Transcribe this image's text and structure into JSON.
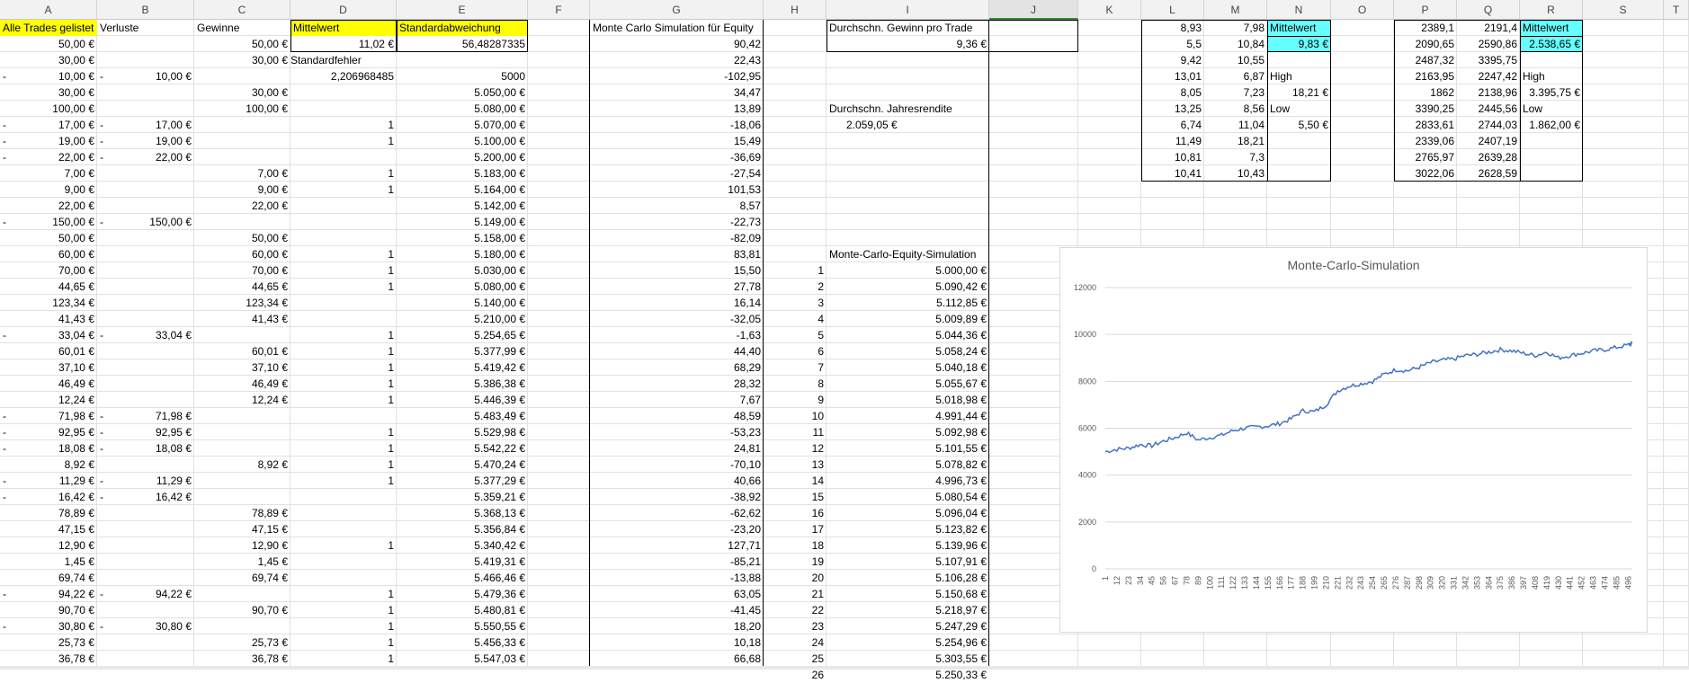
{
  "columns": [
    "A",
    "B",
    "C",
    "D",
    "E",
    "F",
    "G",
    "H",
    "I",
    "J",
    "K",
    "L",
    "M",
    "N",
    "O",
    "P",
    "Q",
    "R",
    "S",
    "T"
  ],
  "selected_column": "J",
  "header_row": {
    "A": "Alle Trades gelistet",
    "B": "Verluste",
    "C": "Gewinne",
    "D": "Mittelwert",
    "E": "Standardabweichung",
    "G": "Monte Carlo Simulation für Equity",
    "I": "Durchschn. Gewinn pro Trade",
    "L": "8,93",
    "M": "7,98",
    "N": "Mittelwert",
    "P": "2389,1",
    "Q": "2191,4",
    "R": "Mittelwert"
  },
  "stats": {
    "mean": "11,02 €",
    "stddev": "56,48287335",
    "std_error_label": "Standardfehler",
    "std_error": "2,206968485",
    "start_capital": "5000",
    "avg_gain_value": "9,36 €",
    "avg_yearly_label": "Durchschn. Jahresrendite",
    "avg_yearly_value": "2.059,05 €",
    "equity_sim_label": "Monte-Carlo-Equity-Simulation"
  },
  "small_table1": {
    "L": [
      "5,5",
      "9,42",
      "13,01",
      "8,05",
      "13,25",
      "6,74",
      "11,49",
      "10,81",
      "10,41"
    ],
    "M": [
      "10,84",
      "10,55",
      "6,87",
      "7,23",
      "8,56",
      "11,04",
      "18,21",
      "7,3",
      "10,43"
    ],
    "N": [
      "9,83 €",
      "",
      "High",
      "18,21 €",
      "Low",
      "5,50 €",
      "",
      "",
      ""
    ]
  },
  "small_table2": {
    "P": [
      "2090,65",
      "2487,32",
      "2163,95",
      "1862",
      "3390,25",
      "2833,61",
      "2339,06",
      "2765,97",
      "3022,06"
    ],
    "Q": [
      "2590,86",
      "3395,75",
      "2247,42",
      "2138,96",
      "2445,56",
      "2744,03",
      "2407,19",
      "2639,28",
      "2628,59"
    ],
    "R": [
      "2.538,65 €",
      "",
      "High",
      "3.395,75 €",
      "Low",
      "1.862,00 €",
      "",
      "",
      ""
    ]
  },
  "colA": [
    "50,00 €",
    "30,00 €",
    "-  10,00 €",
    "30,00 €",
    "100,00 €",
    "-  17,00 €",
    "-  19,00 €",
    "-  22,00 €",
    "7,00 €",
    "9,00 €",
    "22,00 €",
    "-  150,00 €",
    "50,00 €",
    "60,00 €",
    "70,00 €",
    "44,65 €",
    "123,34 €",
    "41,43 €",
    "-  33,04 €",
    "60,01 €",
    "37,10 €",
    "46,49 €",
    "12,24 €",
    "-  71,98 €",
    "-  92,95 €",
    "-  18,08 €",
    "8,92 €",
    "-  11,29 €",
    "-  16,42 €",
    "78,89 €",
    "47,15 €",
    "12,90 €",
    "1,45 €",
    "69,74 €",
    "-  94,22 €",
    "90,70 €",
    "-  30,80 €",
    "25,73 €",
    "36,78 €"
  ],
  "colB": [
    "",
    "",
    "10,00 €",
    "",
    "",
    "17,00 €",
    "19,00 €",
    "22,00 €",
    "",
    "",
    "",
    "150,00 €",
    "",
    "",
    "",
    "",
    "",
    "",
    "33,04 €",
    "",
    "",
    "",
    "",
    "71,98 €",
    "92,95 €",
    "18,08 €",
    "",
    "11,29 €",
    "16,42 €",
    "",
    "",
    "",
    "",
    "",
    "94,22 €",
    "",
    "30,80 €",
    "",
    ""
  ],
  "colC": [
    "50,00 €",
    "30,00 €",
    "",
    "30,00 €",
    "100,00 €",
    "",
    "",
    "",
    "7,00 €",
    "9,00 €",
    "22,00 €",
    "",
    "50,00 €",
    "60,00 €",
    "70,00 €",
    "44,65 €",
    "123,34 €",
    "41,43 €",
    "",
    "60,01 €",
    "37,10 €",
    "46,49 €",
    "12,24 €",
    "",
    "",
    "",
    "8,92 €",
    "",
    "",
    "78,89 €",
    "47,15 €",
    "12,90 €",
    "1,45 €",
    "69,74 €",
    "",
    "90,70 €",
    "",
    "25,73 €",
    "36,78 €"
  ],
  "colD": [
    "",
    "",
    "",
    "",
    "",
    "1",
    "1",
    "",
    "1",
    "1",
    "",
    "",
    "",
    "1",
    "1",
    "1",
    "",
    "",
    "1",
    "1",
    "1",
    "1",
    "1",
    "",
    "1",
    "1",
    "1",
    "1",
    "",
    "",
    "",
    "1",
    "",
    "",
    "1",
    "1",
    "1",
    "1",
    "1"
  ],
  "colE": [
    "",
    "",
    "",
    "5.050,00 €",
    "5.080,00 €",
    "5.070,00 €",
    "5.100,00 €",
    "5.200,00 €",
    "5.183,00 €",
    "5.164,00 €",
    "5.142,00 €",
    "5.149,00 €",
    "5.158,00 €",
    "5.180,00 €",
    "5.030,00 €",
    "5.080,00 €",
    "5.140,00 €",
    "5.210,00 €",
    "5.254,65 €",
    "5.377,99 €",
    "5.419,42 €",
    "5.386,38 €",
    "5.446,39 €",
    "5.483,49 €",
    "5.529,98 €",
    "5.542,22 €",
    "5.470,24 €",
    "5.377,29 €",
    "5.359,21 €",
    "5.368,13 €",
    "5.356,84 €",
    "5.340,42 €",
    "5.419,31 €",
    "5.466,46 €",
    "5.479,36 €",
    "5.480,81 €",
    "5.550,55 €",
    "5.456,33 €",
    "5.547,03 €"
  ],
  "colG": [
    "90,42",
    "22,43",
    "-102,95",
    "34,47",
    "13,89",
    "-18,06",
    "15,49",
    "-36,69",
    "-27,54",
    "101,53",
    "8,57",
    "-22,73",
    "-82,09",
    "83,81",
    "15,50",
    "27,78",
    "16,14",
    "-32,05",
    "-1,63",
    "44,40",
    "68,29",
    "28,32",
    "7,67",
    "48,59",
    "-53,23",
    "24,81",
    "-70,10",
    "40,66",
    "-38,92",
    "-62,62",
    "-23,20",
    "127,71",
    "-85,21",
    "-13,88",
    "63,05",
    "-41,45",
    "18,20",
    "10,18",
    "66,68"
  ],
  "colH": [
    "1",
    "2",
    "3",
    "4",
    "5",
    "6",
    "7",
    "8",
    "9",
    "10",
    "11",
    "12",
    "13",
    "14",
    "15",
    "16",
    "17",
    "18",
    "19",
    "20",
    "21",
    "22",
    "23",
    "24",
    "25",
    "26"
  ],
  "colI": [
    "5.000,00 €",
    "5.090,42 €",
    "5.112,85 €",
    "5.009,89 €",
    "5.044,36 €",
    "5.058,24 €",
    "5.040,18 €",
    "5.055,67 €",
    "5.018,98 €",
    "4.991,44 €",
    "5.092,98 €",
    "5.101,55 €",
    "5.078,82 €",
    "4.996,73 €",
    "5.080,54 €",
    "5.096,04 €",
    "5.123,82 €",
    "5.139,96 €",
    "5.107,91 €",
    "5.106,28 €",
    "5.150,68 €",
    "5.218,97 €",
    "5.247,29 €",
    "5.254,96 €",
    "5.303,55 €",
    "5.250,33 €"
  ],
  "chart_data": {
    "type": "line",
    "title": "Monte-Carlo-Simulation",
    "ylim": [
      0,
      12000
    ],
    "yticks": [
      0,
      2000,
      4000,
      6000,
      8000,
      10000,
      12000
    ],
    "xtick_labels": [
      "1",
      "12",
      "23",
      "34",
      "45",
      "56",
      "67",
      "78",
      "89",
      "100",
      "111",
      "122",
      "133",
      "144",
      "155",
      "166",
      "177",
      "188",
      "199",
      "210",
      "221",
      "232",
      "243",
      "254",
      "265",
      "276",
      "287",
      "298",
      "309",
      "320",
      "331",
      "342",
      "353",
      "364",
      "375",
      "386",
      "397",
      "408",
      "419",
      "430",
      "441",
      "452",
      "463",
      "474",
      "485",
      "496"
    ],
    "x": [
      1,
      12,
      23,
      34,
      45,
      56,
      67,
      78,
      89,
      100,
      111,
      122,
      133,
      144,
      155,
      166,
      177,
      188,
      199,
      210,
      221,
      232,
      243,
      254,
      265,
      276,
      287,
      298,
      309,
      320,
      331,
      342,
      353,
      364,
      375,
      386,
      397,
      408,
      419,
      430,
      441,
      452,
      463,
      474,
      485,
      496,
      500
    ],
    "series": [
      {
        "name": "",
        "color": "#4472c4",
        "values": [
          5000,
          5100,
          5150,
          5300,
          5250,
          5450,
          5600,
          5800,
          5500,
          5600,
          5700,
          5900,
          6000,
          6050,
          6100,
          6200,
          6400,
          6750,
          6700,
          7000,
          7600,
          7800,
          7900,
          8000,
          8300,
          8500,
          8450,
          8600,
          8800,
          8900,
          8950,
          9100,
          9150,
          9250,
          9350,
          9300,
          9200,
          9100,
          9250,
          9000,
          9100,
          9200,
          9300,
          9350,
          9450,
          9550,
          9650
        ]
      }
    ],
    "grid": true,
    "legend": "none"
  }
}
